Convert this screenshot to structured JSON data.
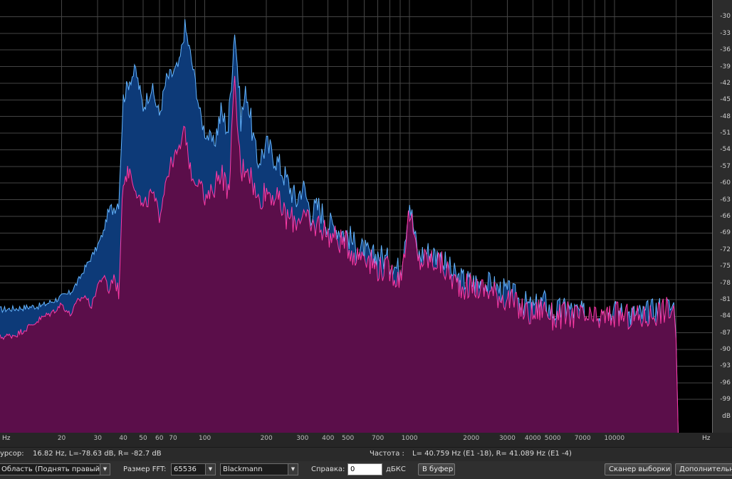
{
  "chart_data": {
    "type": "area",
    "x_scale": "log",
    "xlim": [
      10,
      30000
    ],
    "ylim": [
      -105,
      -27
    ],
    "xlabel": "Hz",
    "ylabel": "dB",
    "x_tick_labels": [
      "20",
      "30",
      "40",
      "50",
      "60",
      "70",
      "100",
      "200",
      "300",
      "400",
      "500",
      "700",
      "1000",
      "2000",
      "3000",
      "4000",
      "5000",
      "7000",
      "10000"
    ],
    "y_tick_labels": [
      "-30",
      "-33",
      "-36",
      "-39",
      "-42",
      "-45",
      "-48",
      "-51",
      "-54",
      "-57",
      "-60",
      "-63",
      "-66",
      "-69",
      "-72",
      "-75",
      "-78",
      "-81",
      "-84",
      "-87",
      "-90",
      "-93",
      "-96",
      "-99",
      "dB"
    ],
    "series": [
      {
        "channel": "L",
        "color": "#0d3a78",
        "line_color": "#63b4ff",
        "x": [
          10,
          12,
          14,
          16,
          18,
          20,
          22,
          24,
          26,
          28,
          30,
          32,
          34,
          36,
          38,
          40,
          43,
          46,
          50,
          55,
          60,
          65,
          70,
          75,
          80,
          85,
          90,
          95,
          100,
          110,
          120,
          130,
          140,
          150,
          160,
          170,
          180,
          200,
          220,
          250,
          280,
          300,
          330,
          360,
          400,
          450,
          500,
          550,
          600,
          650,
          700,
          800,
          900,
          1000,
          1100,
          1200,
          1400,
          1700,
          2000,
          2400,
          3000,
          3500,
          4000,
          4500,
          5000,
          6000,
          7000,
          8000,
          10000,
          12000,
          14000,
          16000,
          18000,
          19500,
          20000,
          20500
        ],
        "values": [
          -82.5,
          -82.3,
          -82.0,
          -81.8,
          -81.0,
          -80.2,
          -79.5,
          -77.5,
          -75.0,
          -73.0,
          -71.0,
          -68.5,
          -64.5,
          -63.5,
          -62.5,
          -44.0,
          -40.5,
          -39.0,
          -45.5,
          -42.0,
          -47.0,
          -40.5,
          -39.5,
          -38.0,
          -31.0,
          -36.0,
          -41.0,
          -47.0,
          -50.0,
          -52.0,
          -46.0,
          -49.0,
          -30.5,
          -47.0,
          -42.0,
          -49.0,
          -55.0,
          -52.0,
          -54.0,
          -58.0,
          -62.0,
          -59.0,
          -64.0,
          -63.0,
          -66.0,
          -67.0,
          -68.0,
          -70.5,
          -71.0,
          -72.5,
          -71.5,
          -73.0,
          -74.5,
          -62.0,
          -72.0,
          -71.0,
          -72.0,
          -76.0,
          -76.5,
          -77.0,
          -78.5,
          -80.0,
          -81.5,
          -80.0,
          -82.0,
          -81.5,
          -82.5,
          -83.0,
          -82.0,
          -82.5,
          -82.5,
          -81.5,
          -81.0,
          -81.5,
          -87.5,
          -105.0
        ]
      },
      {
        "channel": "R",
        "color": "#5b0e4a",
        "line_color": "#ff3aa6",
        "x": [
          10,
          12,
          14,
          16,
          18,
          20,
          22,
          24,
          26,
          28,
          30,
          32,
          34,
          36,
          38,
          40,
          43,
          46,
          50,
          55,
          60,
          65,
          70,
          75,
          80,
          85,
          90,
          95,
          100,
          110,
          120,
          130,
          140,
          150,
          160,
          170,
          180,
          200,
          220,
          250,
          280,
          300,
          330,
          360,
          400,
          450,
          500,
          550,
          600,
          650,
          700,
          800,
          900,
          1000,
          1100,
          1200,
          1400,
          1700,
          2000,
          2400,
          3000,
          3500,
          4000,
          4500,
          5000,
          6000,
          7000,
          8000,
          10000,
          12000,
          14000,
          16000,
          18000,
          19500,
          20000,
          20500
        ],
        "values": [
          -87.5,
          -87.0,
          -85.5,
          -84.0,
          -83.0,
          -81.5,
          -83.5,
          -81.0,
          -80.0,
          -82.0,
          -78.0,
          -76.5,
          -78.5,
          -76.0,
          -79.0,
          -58.5,
          -57.0,
          -60.0,
          -64.0,
          -61.0,
          -65.0,
          -58.0,
          -55.0,
          -53.5,
          -49.5,
          -57.0,
          -59.0,
          -58.0,
          -63.0,
          -60.0,
          -56.0,
          -61.0,
          -41.0,
          -57.0,
          -55.0,
          -58.0,
          -62.0,
          -60.0,
          -61.0,
          -65.0,
          -65.5,
          -64.0,
          -67.0,
          -66.0,
          -68.0,
          -69.0,
          -70.0,
          -72.0,
          -71.0,
          -73.0,
          -74.0,
          -74.5,
          -76.0,
          -64.0,
          -73.0,
          -72.5,
          -73.0,
          -77.0,
          -77.5,
          -78.0,
          -79.5,
          -81.5,
          -82.5,
          -81.0,
          -83.0,
          -82.5,
          -83.0,
          -83.5,
          -82.5,
          -83.0,
          -83.0,
          -82.0,
          -81.5,
          -82.0,
          -88.0,
          -105.0
        ]
      }
    ],
    "grid": true,
    "background": "#000000",
    "grid_color": "#444444"
  },
  "status": {
    "cursor_label": "урсор:",
    "cursor_value": "16.82 Hz, L=-78.63 dB, R= -82.7 dB",
    "freq_label": "Частота :",
    "freq_value": "L= 40.759 Hz (E1 -18), R= 41.089 Hz (E1 -4)"
  },
  "controls": {
    "region_select": "Область (Поднять правый)",
    "fft_label": "Размер FFT:",
    "fft_value": "65536",
    "window_value": "Blackmann",
    "ref_label": "Справка:",
    "ref_value": "0",
    "ref_unit": "дБКС",
    "copy_button": "В буфер",
    "scan_button": "Сканер выборки",
    "more_button": "Дополнительно"
  },
  "icons": {
    "dropdown": "chevron-down-icon"
  }
}
